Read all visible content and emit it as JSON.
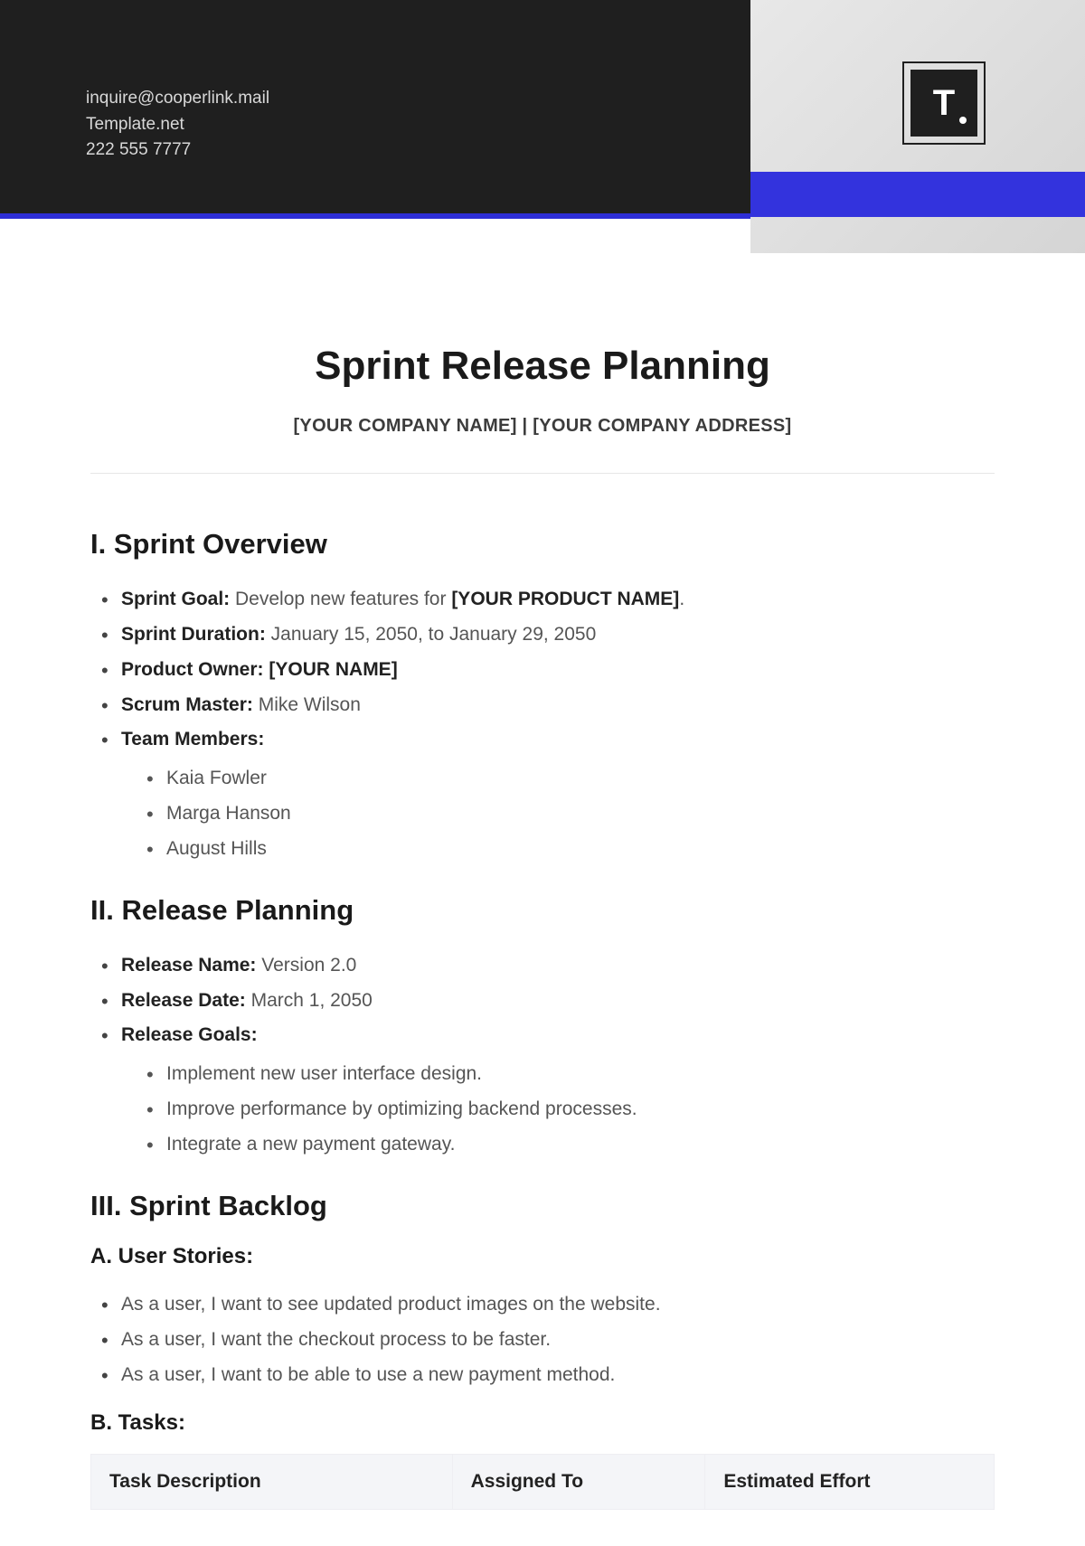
{
  "header": {
    "email": "inquire@cooperlink.mail",
    "site": "Template.net",
    "phone": "222 555 7777",
    "logo_letter": "T"
  },
  "title": "Sprint Release Planning",
  "subtitle": {
    "company_name": "[YOUR COMPANY NAME]",
    "separator": " | ",
    "company_address": "[YOUR COMPANY ADDRESS]"
  },
  "sections": {
    "overview": {
      "heading": "I. Sprint Overview",
      "goal_label": "Sprint Goal:",
      "goal_text": " Develop new features for ",
      "goal_product": "[YOUR PRODUCT NAME]",
      "goal_suffix": ".",
      "duration_label": "Sprint Duration:",
      "duration_value": " January 15, 2050, to January 29, 2050",
      "owner_label": "Product Owner: ",
      "owner_value": "[YOUR NAME]",
      "master_label": "Scrum Master:",
      "master_value": " Mike Wilson",
      "members_label": "Team Members:",
      "members": [
        "Kaia Fowler",
        "Marga Hanson",
        "August Hills"
      ]
    },
    "release": {
      "heading": "II. Release Planning",
      "name_label": "Release Name:",
      "name_value": " Version 2.0",
      "date_label": "Release Date:",
      "date_value": " March 1, 2050",
      "goals_label": "Release Goals:",
      "goals": [
        "Implement new user interface design.",
        "Improve performance by optimizing backend processes.",
        "Integrate a new payment gateway."
      ]
    },
    "backlog": {
      "heading": "III. Sprint Backlog",
      "stories_heading": "A. User Stories:",
      "stories": [
        "As a user, I want to see updated product images on the website.",
        "As a user, I want the checkout process to be faster.",
        "As a user, I want to be able to use a new payment method."
      ],
      "tasks_heading": "B. Tasks:",
      "table_headers": [
        "Task Description",
        "Assigned To",
        "Estimated Effort"
      ]
    }
  }
}
